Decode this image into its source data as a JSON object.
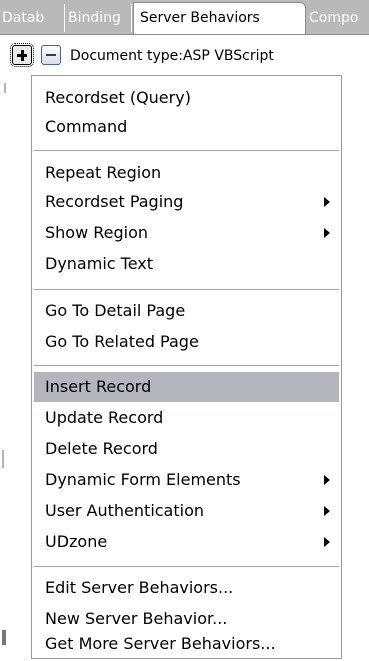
{
  "tabs": [
    {
      "label": "Datab"
    },
    {
      "label": "Binding"
    },
    {
      "label": "Server Behaviors"
    },
    {
      "label": "Compo"
    }
  ],
  "toolbar": {
    "add_icon": "plus-icon",
    "remove_icon": "minus-icon",
    "document_type": "Document type:ASP VBScript"
  },
  "menu": {
    "group1": [
      {
        "label": "Recordset (Query)"
      },
      {
        "label": "Command"
      }
    ],
    "group2": [
      {
        "label": "Repeat Region"
      },
      {
        "label": "Recordset Paging",
        "submenu": true
      },
      {
        "label": "Show Region",
        "submenu": true
      },
      {
        "label": "Dynamic Text"
      }
    ],
    "group3": [
      {
        "label": "Go To Detail Page"
      },
      {
        "label": "Go To Related Page"
      }
    ],
    "group4": [
      {
        "label": "Insert Record",
        "highlighted": true
      },
      {
        "label": "Update Record"
      },
      {
        "label": "Delete Record"
      },
      {
        "label": "Dynamic Form Elements",
        "submenu": true
      },
      {
        "label": "User Authentication",
        "submenu": true
      },
      {
        "label": "UDzone",
        "submenu": true
      }
    ],
    "group5": [
      {
        "label": "Edit Server Behaviors..."
      },
      {
        "label": "New Server Behavior..."
      },
      {
        "label": "Get More Server Behaviors..."
      }
    ]
  },
  "colors": {
    "tab_strip": "#b9b9b9",
    "highlight": "#b5b5bd",
    "separator": "#a6a6a6"
  }
}
